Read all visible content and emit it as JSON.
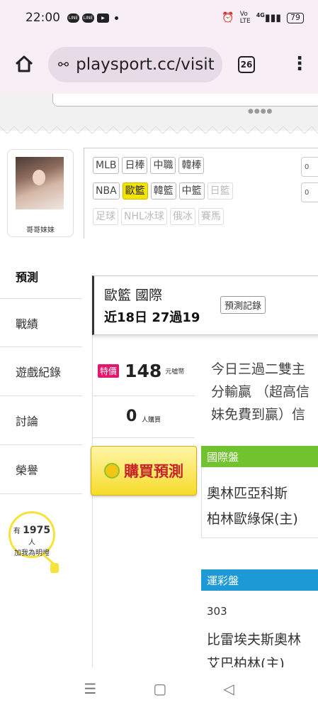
{
  "status_bar": {
    "time": "22:00",
    "network": "4G",
    "battery": "79"
  },
  "browser": {
    "url": "playsport.cc/visit",
    "tab_count": "26"
  },
  "profile": {
    "nickname": "哥哥妹妹"
  },
  "leagues": {
    "row1": [
      "MLB",
      "日棒",
      "中職",
      "韓棒"
    ],
    "row2": [
      "NBA",
      "歐籃",
      "韓籃",
      "中籃",
      "日籃"
    ],
    "row3": [
      "足球",
      "NHL冰球",
      "俄冰",
      "賽馬"
    ],
    "side": [
      "0",
      "0"
    ]
  },
  "side_nav": [
    "預測",
    "戰績",
    "遊戲紀錄",
    "討論",
    "榮譽"
  ],
  "followers": {
    "prefix": "有",
    "count": "1975",
    "suffix": "人",
    "caption": "加我為明燈"
  },
  "header": {
    "title": "歐籃 國際",
    "record": "近18日 27過19",
    "button": "預測記錄"
  },
  "pricing": {
    "badge": "特價",
    "price": "148",
    "unit": "元噓幣",
    "buyers": "0",
    "buyers_unit": "人購買"
  },
  "description": [
    "今日三過二雙主",
    "分輸贏 （超高信",
    "妹免費到贏）信"
  ],
  "buy_button": {
    "label": "購買預測"
  },
  "market_intl": {
    "title": "國際盤",
    "teams": [
      "奧林匹亞科斯",
      "柏林歐綠保(主)"
    ]
  },
  "market_lottery": {
    "title": "運彩盤",
    "number": "303",
    "teams": [
      "比雷埃夫斯奧林",
      "艾巴柏林(主)"
    ]
  },
  "colors": {
    "accent_yellow": "#f5e400",
    "green": "#70c22f",
    "blue": "#1d9ad6",
    "badge_pink": "#e2176b"
  }
}
